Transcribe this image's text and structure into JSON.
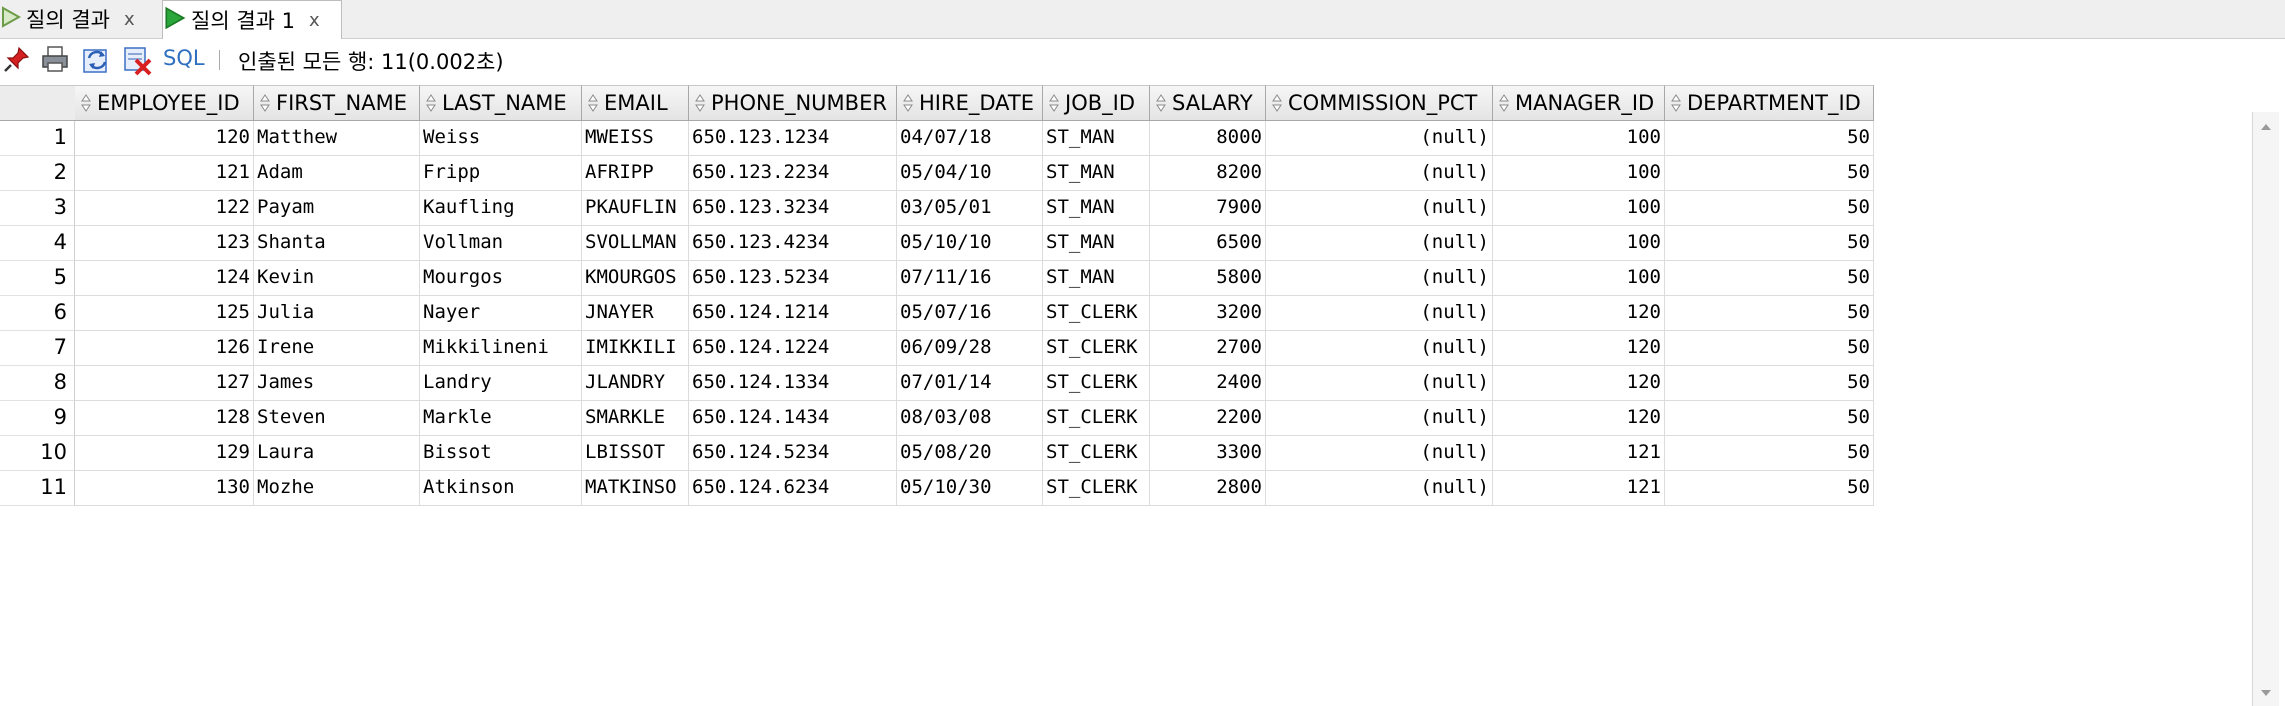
{
  "tabs": [
    {
      "label": "질의 결과",
      "close": "x"
    },
    {
      "label": "질의 결과 1",
      "close": "x"
    }
  ],
  "toolbar": {
    "icons": [
      "pin-icon",
      "print-icon",
      "refresh-icon",
      "delete-icon"
    ],
    "sql_label": "SQL",
    "status": "인출된 모든 행: 11(0.002초)"
  },
  "grid": {
    "columns": [
      "EMPLOYEE_ID",
      "FIRST_NAME",
      "LAST_NAME",
      "EMAIL",
      "PHONE_NUMBER",
      "HIRE_DATE",
      "JOB_ID",
      "SALARY",
      "COMMISSION_PCT",
      "MANAGER_ID",
      "DEPARTMENT_ID"
    ],
    "rows": [
      [
        "1",
        "120",
        "Matthew",
        "Weiss",
        "MWEISS",
        "650.123.1234",
        "04/07/18",
        "ST_MAN",
        "8000",
        "(null)",
        "100",
        "50"
      ],
      [
        "2",
        "121",
        "Adam",
        "Fripp",
        "AFRIPP",
        "650.123.2234",
        "05/04/10",
        "ST_MAN",
        "8200",
        "(null)",
        "100",
        "50"
      ],
      [
        "3",
        "122",
        "Payam",
        "Kaufling",
        "PKAUFLIN",
        "650.123.3234",
        "03/05/01",
        "ST_MAN",
        "7900",
        "(null)",
        "100",
        "50"
      ],
      [
        "4",
        "123",
        "Shanta",
        "Vollman",
        "SVOLLMAN",
        "650.123.4234",
        "05/10/10",
        "ST_MAN",
        "6500",
        "(null)",
        "100",
        "50"
      ],
      [
        "5",
        "124",
        "Kevin",
        "Mourgos",
        "KMOURGOS",
        "650.123.5234",
        "07/11/16",
        "ST_MAN",
        "5800",
        "(null)",
        "100",
        "50"
      ],
      [
        "6",
        "125",
        "Julia",
        "Nayer",
        "JNAYER",
        "650.124.1214",
        "05/07/16",
        "ST_CLERK",
        "3200",
        "(null)",
        "120",
        "50"
      ],
      [
        "7",
        "126",
        "Irene",
        "Mikkilineni",
        "IMIKKILI",
        "650.124.1224",
        "06/09/28",
        "ST_CLERK",
        "2700",
        "(null)",
        "120",
        "50"
      ],
      [
        "8",
        "127",
        "James",
        "Landry",
        "JLANDRY",
        "650.124.1334",
        "07/01/14",
        "ST_CLERK",
        "2400",
        "(null)",
        "120",
        "50"
      ],
      [
        "9",
        "128",
        "Steven",
        "Markle",
        "SMARKLE",
        "650.124.1434",
        "08/03/08",
        "ST_CLERK",
        "2200",
        "(null)",
        "120",
        "50"
      ],
      [
        "10",
        "129",
        "Laura",
        "Bissot",
        "LBISSOT",
        "650.124.5234",
        "05/08/20",
        "ST_CLERK",
        "3300",
        "(null)",
        "121",
        "50"
      ],
      [
        "11",
        "130",
        "Mozhe",
        "Atkinson",
        "MATKINSO",
        "650.124.6234",
        "05/10/30",
        "ST_CLERK",
        "2800",
        "(null)",
        "121",
        "50"
      ]
    ]
  }
}
